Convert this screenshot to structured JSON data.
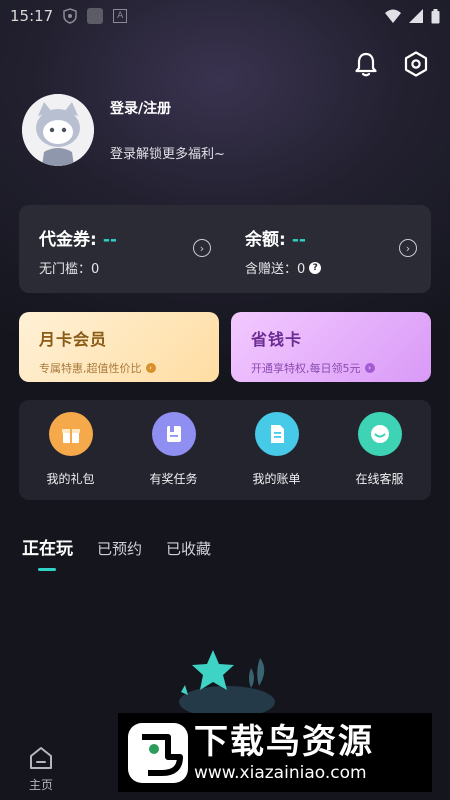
{
  "status_bar": {
    "time": "15:17"
  },
  "profile": {
    "login_label": "登录/注册",
    "subtitle": "登录解锁更多福利~"
  },
  "wallet": {
    "voucher_label": "代金券:",
    "voucher_value": "--",
    "voucher_sub": "无门槛：0",
    "balance_label": "余额:",
    "balance_value": "--",
    "balance_sub": "含赠送：0"
  },
  "promos": {
    "monthly_title": "月卡会员",
    "monthly_sub": "专属特惠,超值性价比",
    "saver_title": "省钱卡",
    "saver_sub": "开通享特权,每日领5元"
  },
  "shortcuts": [
    {
      "label": "我的礼包",
      "icon": "gift-icon",
      "color": "#f5a94a"
    },
    {
      "label": "有奖任务",
      "icon": "task-icon",
      "color": "#8f8ff2"
    },
    {
      "label": "我的账单",
      "icon": "bill-icon",
      "color": "#47c9e8"
    },
    {
      "label": "在线客服",
      "icon": "chat-icon",
      "color": "#3fd3b6"
    }
  ],
  "tabs": [
    "正在玩",
    "已预约",
    "已收藏"
  ],
  "bottom_nav": {
    "home_label": "主页"
  },
  "watermark": {
    "title": "下载鸟资源",
    "url": "www.xiazainiao.com"
  },
  "colors": {
    "accent": "#2ed3c6",
    "card_bg": "#2a2b34"
  }
}
